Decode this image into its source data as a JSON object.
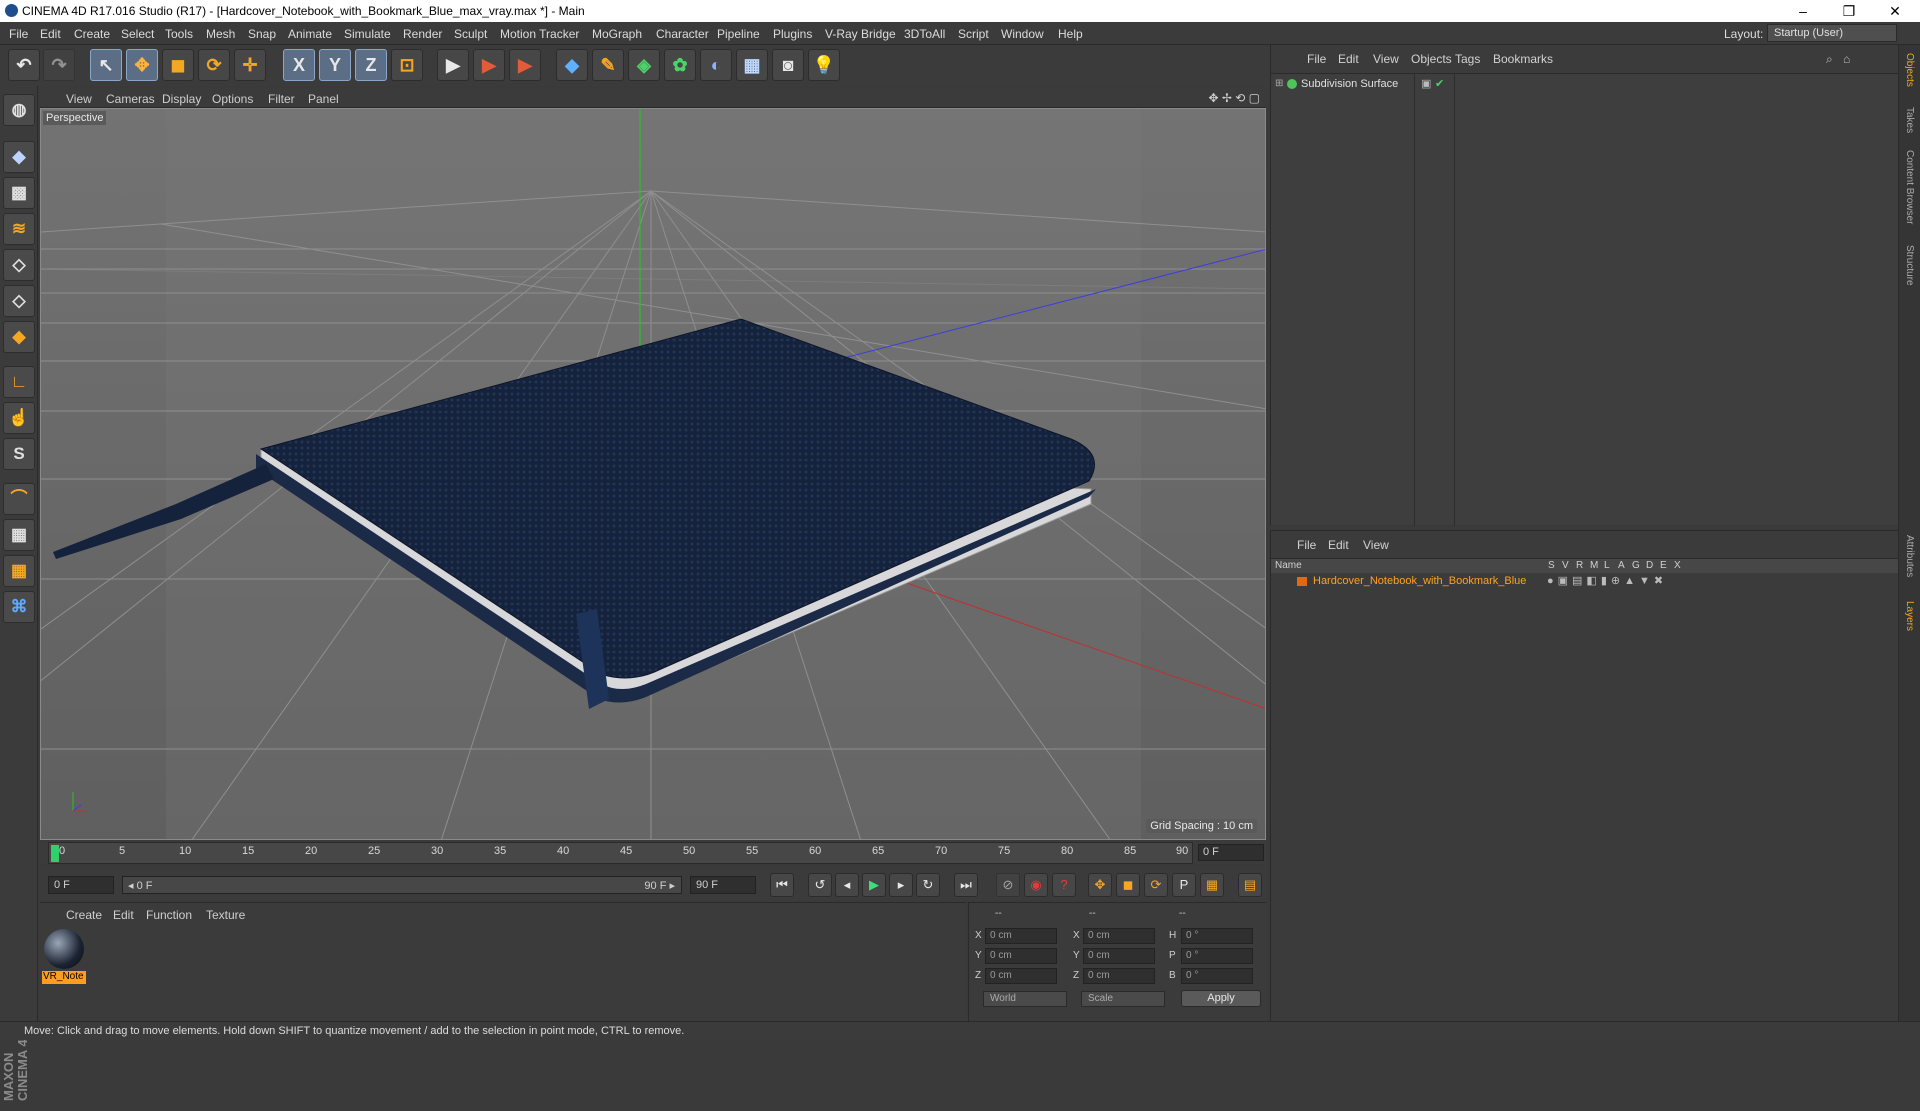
{
  "window": {
    "title": "CINEMA 4D R17.016 Studio (R17) - [Hardcover_Notebook_with_Bookmark_Blue_max_vray.max *] - Main",
    "minimize": "–",
    "maximize": "❐",
    "close": "✕"
  },
  "menu": [
    "File",
    "Edit",
    "Create",
    "Select",
    "Tools",
    "Mesh",
    "Snap",
    "Animate",
    "Simulate",
    "Render",
    "Sculpt",
    "Motion Tracker",
    "MoGraph",
    "Character",
    "Pipeline",
    "Plugins",
    "V-Ray Bridge",
    "3DToAll",
    "Script",
    "Window",
    "Help"
  ],
  "layout": {
    "label": "Layout:",
    "value": "Startup (User)"
  },
  "toolbar": {
    "undo": "↶",
    "redo": "↷",
    "select": "↖",
    "move": "✥",
    "scale": "◼",
    "rotate": "⟳",
    "transform": "✛",
    "axis_x": "X",
    "axis_y": "Y",
    "axis_z": "Z",
    "coord": "⊡",
    "render_view": "▶",
    "render_pv": "▶",
    "render_settings": "▶",
    "cube": "◆",
    "pen": "✎",
    "subdiv": "◈",
    "array": "✿",
    "deformer": "◐",
    "floor": "▦",
    "camera": "◙",
    "light": "💡"
  },
  "viewport": {
    "menu": [
      "View",
      "Cameras",
      "Display",
      "Options",
      "Filter",
      "Panel"
    ],
    "label": "Perspective",
    "grid_spacing": "Grid Spacing : 10 cm"
  },
  "timeline": {
    "ticks": [
      "0",
      "5",
      "10",
      "15",
      "20",
      "25",
      "30",
      "35",
      "40",
      "45",
      "50",
      "55",
      "60",
      "65",
      "70",
      "75",
      "80",
      "85",
      "90"
    ],
    "current": "0 F"
  },
  "transport": {
    "start": "0 F",
    "range_start": "◂ 0 F",
    "range_end": "90 F ▸",
    "end": "90 F"
  },
  "materials": {
    "menu": [
      "Create",
      "Edit",
      "Function",
      "Texture"
    ],
    "items": [
      {
        "label": "VR_Note"
      }
    ]
  },
  "coordinates": {
    "headers": [
      "--",
      "--",
      "--"
    ],
    "rows": [
      {
        "a": "X",
        "av": "0 cm",
        "b": "X",
        "bv": "0 cm",
        "c": "H",
        "cv": "0 °"
      },
      {
        "a": "Y",
        "av": "0 cm",
        "b": "Y",
        "bv": "0 cm",
        "c": "P",
        "cv": "0 °"
      },
      {
        "a": "Z",
        "av": "0 cm",
        "b": "Z",
        "bv": "0 cm",
        "c": "B",
        "cv": "0 °"
      }
    ],
    "mode": "World",
    "scale": "Scale",
    "apply": "Apply"
  },
  "object_manager": {
    "menu": [
      "File",
      "Edit",
      "View",
      "Objects",
      "Tags",
      "Bookmarks"
    ],
    "object": "Subdivision Surface"
  },
  "layer_manager": {
    "menu": [
      "File",
      "Edit",
      "View"
    ],
    "columns": [
      "Name",
      "S",
      "V",
      "R",
      "M",
      "L",
      "A",
      "G",
      "D",
      "E",
      "X"
    ],
    "layer": "Hardcover_Notebook_with_Bookmark_Blue"
  },
  "right_tabs": [
    "Objects",
    "Takes",
    "Content Browser",
    "Structure",
    "Attributes",
    "Layers"
  ],
  "status": "Move: Click and drag to move elements. Hold down SHIFT to quantize movement / add to the selection in point mode, CTRL to remove.",
  "maxon": {
    "line1": "MAXON",
    "line2": "CINEMA 4D"
  },
  "colors": {
    "accent": "#ff9d1c",
    "layer": "#ffa21f",
    "notebook": "#14203a"
  }
}
